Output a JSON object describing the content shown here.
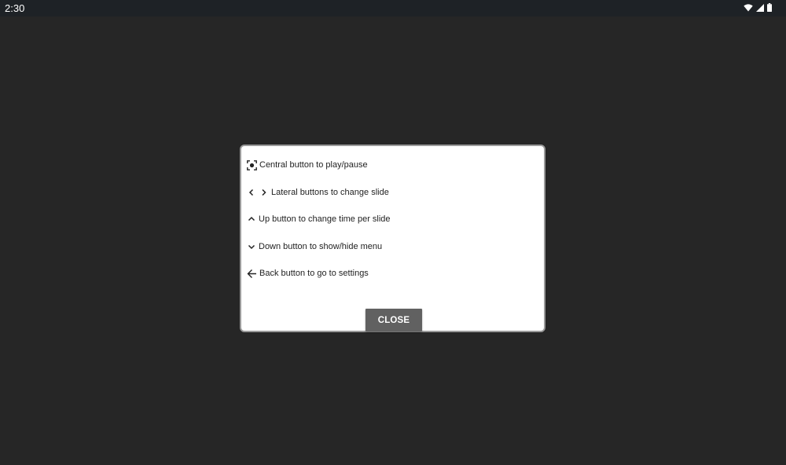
{
  "status_bar": {
    "time": "2:30",
    "icons": [
      "wifi-icon",
      "cellular-signal-icon",
      "battery-icon"
    ]
  },
  "dialog": {
    "instructions": [
      {
        "icon": "focus-center-icon",
        "label": "Central button to play/pause"
      },
      {
        "icon": "chevron-left-right-icon",
        "label": "Lateral buttons to change slide"
      },
      {
        "icon": "chevron-up-icon",
        "label": "Up button to change time per slide"
      },
      {
        "icon": "chevron-down-icon",
        "label": "Down button to show/hide menu"
      },
      {
        "icon": "arrow-back-icon",
        "label": "Back button to go to settings"
      }
    ],
    "close_label": "CLOSE"
  },
  "colors": {
    "background": "#262626",
    "status_bar": "#1e2226",
    "dialog": "#ffffff",
    "button": "#616161"
  }
}
